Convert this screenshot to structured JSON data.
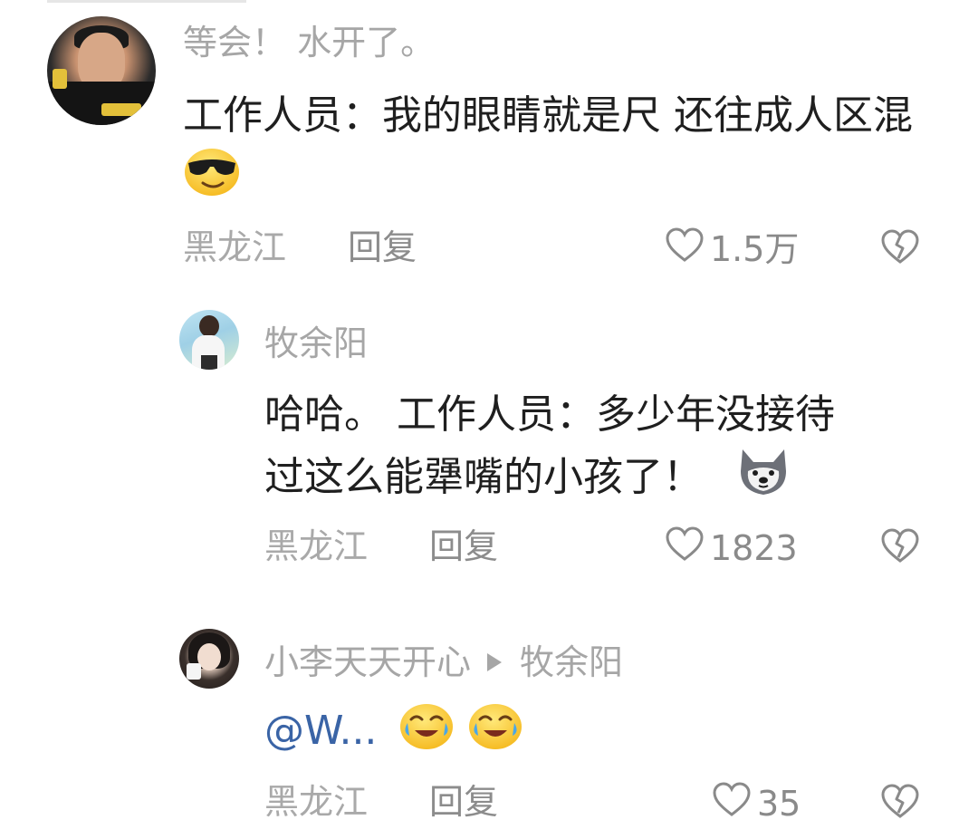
{
  "comments": [
    {
      "username": "等会！ 水开了。",
      "text": "工作人员：我的眼睛就是尺  还往成人区混",
      "emoji": "sunglasses-emoji",
      "location": "黑龙江",
      "reply_label": "回复",
      "likes": "1.5万"
    },
    {
      "username": "牧余阳",
      "text_line1": "哈哈。 工作人员：多少年没接待",
      "text_line2": "过这么能犟嘴的小孩了！",
      "emoji": "husky-emoji",
      "location": "黑龙江",
      "reply_label": "回复",
      "likes": "1823"
    },
    {
      "username": "小李天天开心",
      "reply_to": "牧余阳",
      "mention": "@W...",
      "emoji": "crying-laughing-emoji",
      "location": "黑龙江",
      "reply_label": "回复",
      "likes": "35"
    }
  ],
  "icons": {
    "like": "heart-outline-icon",
    "dislike": "broken-heart-icon",
    "reply_arrow": "triangle-right-icon"
  },
  "colors": {
    "text": "#1f1f1f",
    "meta": "#a9a9a9",
    "mention": "#3a64a6",
    "background": "#ffffff"
  }
}
